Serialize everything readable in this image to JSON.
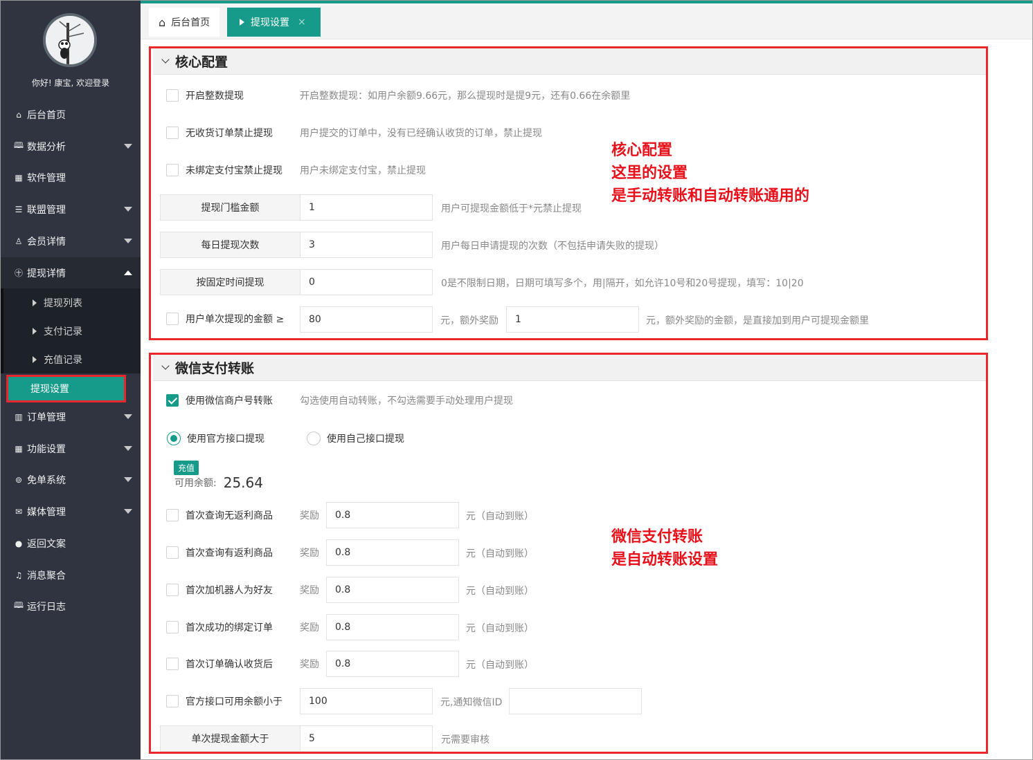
{
  "sidebar": {
    "welcome": "你好! 康宝, 欢迎登录",
    "items": [
      {
        "label": "后台首页",
        "icon": "⌂",
        "icon_name": "home-icon",
        "arrow": false
      },
      {
        "label": "数据分析",
        "icon": "🕮",
        "icon_name": "book-icon",
        "arrow": true
      },
      {
        "label": "软件管理",
        "icon": "▦",
        "icon_name": "grid-icon",
        "arrow": false
      },
      {
        "label": "联盟管理",
        "icon": "☰",
        "icon_name": "list-icon",
        "arrow": true
      },
      {
        "label": "会员详情",
        "icon": "♙",
        "icon_name": "user-icon",
        "arrow": true
      },
      {
        "label": "提现详情",
        "icon": "㊉",
        "icon_name": "money-icon",
        "arrow": true,
        "open": true
      },
      {
        "label": "订单管理",
        "icon": "▥",
        "icon_name": "table-icon",
        "arrow": true
      },
      {
        "label": "功能设置",
        "icon": "▦",
        "icon_name": "grid-icon",
        "arrow": true
      },
      {
        "label": "免单系统",
        "icon": "⊚",
        "icon_name": "free-icon",
        "arrow": true
      },
      {
        "label": "媒体管理",
        "icon": "✉",
        "icon_name": "media-icon",
        "arrow": true
      },
      {
        "label": "返回文案",
        "icon": "●",
        "icon_name": "chat-icon",
        "arrow": false
      },
      {
        "label": "消息聚合",
        "icon": "♫",
        "icon_name": "bell-icon",
        "arrow": false
      },
      {
        "label": "运行日志",
        "icon": "🕮",
        "icon_name": "log-icon",
        "arrow": false
      }
    ],
    "sub_items": [
      "提现列表",
      "支付记录",
      "充值记录",
      "提现设置"
    ]
  },
  "tabs": {
    "home": "后台首页",
    "active": "提现设置",
    "close": "×"
  },
  "core": {
    "title": "核心配置",
    "checks": [
      {
        "label": "开启整数提现",
        "hint": "开启整数提现：如用户余额9.66元，那么提现时是提9元，还有0.66在余额里"
      },
      {
        "label": "无收货订单禁止提现",
        "hint": "用户提交的订单中，没有已经确认收货的订单，禁止提现"
      },
      {
        "label": "未绑定支付宝禁止提现",
        "hint": "用户未绑定支付宝，禁止提现"
      }
    ],
    "fields": [
      {
        "label": "提现门槛金额",
        "value": "1",
        "hint": "用户可提现金额低于*元禁止提现"
      },
      {
        "label": "每日提现次数",
        "value": "3",
        "hint": "用户每日申请提现的次数（不包括申请失败的提现）"
      },
      {
        "label": "按固定时间提现",
        "value": "0",
        "hint": "0是不限制日期，日期可填写多个，用|隔开，如允许10号和20号提现，填写：10|20"
      }
    ],
    "bonus": {
      "label": "用户单次提现的金额 ≥",
      "value": "80",
      "mid": "元，额外奖励",
      "value2": "1",
      "hint": "元，额外奖励的金额，是直接加到用户可提现金额里"
    }
  },
  "wechat": {
    "title": "微信支付转账",
    "use_merchant": {
      "label": "使用微信商户号转账",
      "hint": "勾选使用自动转账，不勾选需要手动处理用户提现"
    },
    "radio_official": "使用官方接口提现",
    "radio_own": "使用自己接口提现",
    "recharge": "充值",
    "balance_label": "可用余额:",
    "balance_value": "25.64",
    "rewards": [
      {
        "label": "首次查询无返利商品",
        "prefix": "奖励",
        "value": "0.8",
        "suffix": "元（自动到账）"
      },
      {
        "label": "首次查询有返利商品",
        "prefix": "奖励",
        "value": "0.8",
        "suffix": "元（自动到账）"
      },
      {
        "label": "首次加机器人为好友",
        "prefix": "奖励",
        "value": "0.8",
        "suffix": "元（自动到账）"
      },
      {
        "label": "首次成功的绑定订单",
        "prefix": "奖励",
        "value": "0.8",
        "suffix": "元（自动到账）"
      },
      {
        "label": "首次订单确认收货后",
        "prefix": "奖励",
        "value": "0.8",
        "suffix": "元（自动到账）"
      }
    ],
    "low_balance": {
      "label": "官方接口可用余额小于",
      "value": "100",
      "mid": "元,通知微信ID",
      "value2": ""
    },
    "audit": {
      "label": "单次提现金额大于",
      "value": "5",
      "hint": "元需要审核"
    }
  },
  "annotations": {
    "core": [
      "核心配置",
      "这里的设置",
      "是手动转账和自动转账通用的"
    ],
    "wechat": [
      "微信支付转账",
      "是自动转账设置"
    ]
  },
  "colors": {
    "accent": "#169a89",
    "sidebar": "#2f3440",
    "annotation": "#e8101a"
  }
}
